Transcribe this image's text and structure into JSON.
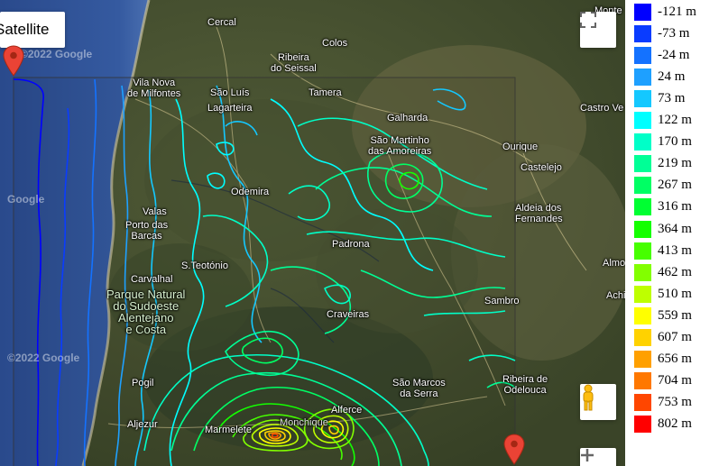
{
  "map": {
    "maptype_label": "Satellite",
    "watermark": "©2022 Google",
    "watermark2": "Google",
    "places": [
      {
        "id": "cercal",
        "text": "Cercal"
      },
      {
        "id": "ribeira-seissal",
        "text": "Ribeira\ndo Seissal"
      },
      {
        "id": "colos",
        "text": "Colos"
      },
      {
        "id": "monte",
        "text": "Monte"
      },
      {
        "id": "vila-nova",
        "text": "Vila Nova\nde Milfontes"
      },
      {
        "id": "sao-luis",
        "text": "São Luís"
      },
      {
        "id": "tamera",
        "text": "Tamera"
      },
      {
        "id": "lagarteira",
        "text": "Lagarteira"
      },
      {
        "id": "galharda",
        "text": "Galharda"
      },
      {
        "id": "castro-verde",
        "text": "Castro Ve"
      },
      {
        "id": "sao-martinho",
        "text": "São Martinho\ndas Amoreiras"
      },
      {
        "id": "ourique",
        "text": "Ourique"
      },
      {
        "id": "castelejo",
        "text": "Castelejo"
      },
      {
        "id": "odemira",
        "text": "Odemira"
      },
      {
        "id": "valas",
        "text": "Valas"
      },
      {
        "id": "aldeia",
        "text": "Aldeia dos\nFernandes"
      },
      {
        "id": "porto-barcas",
        "text": "Porto das\nBarcas"
      },
      {
        "id": "padrona",
        "text": "Padrona"
      },
      {
        "id": "s-teotonio",
        "text": "S.Teotónio"
      },
      {
        "id": "almo",
        "text": "Almo"
      },
      {
        "id": "carvalhal",
        "text": "Carvalhal"
      },
      {
        "id": "parque",
        "text": "Parque Natural\ndo Sudoeste\nAlentejano\ne Costa"
      },
      {
        "id": "achi",
        "text": "Achi"
      },
      {
        "id": "sambro",
        "text": "Sambro"
      },
      {
        "id": "craveiras",
        "text": "Craveiras"
      },
      {
        "id": "pogil",
        "text": "Pogil"
      },
      {
        "id": "sao-marcos",
        "text": "São Marcos\nda Serra"
      },
      {
        "id": "ribeira-odelouca",
        "text": "Ribeira de\nOdelouca"
      },
      {
        "id": "aljezur",
        "text": "Aljezur"
      },
      {
        "id": "marmelete",
        "text": "Marmelete"
      },
      {
        "id": "monchique",
        "text": "Monchique"
      },
      {
        "id": "alferce",
        "text": "Alferce"
      }
    ]
  },
  "legend": {
    "items": [
      {
        "label": "-121 m",
        "color": "#0000ff"
      },
      {
        "label": "-73 m",
        "color": "#0a3cff"
      },
      {
        "label": "-24 m",
        "color": "#1472ff"
      },
      {
        "label": "24 m",
        "color": "#1ea0ff"
      },
      {
        "label": "73 m",
        "color": "#14c8ff"
      },
      {
        "label": "122 m",
        "color": "#00ffff"
      },
      {
        "label": "170 m",
        "color": "#00ffc8"
      },
      {
        "label": "219 m",
        "color": "#00ff96"
      },
      {
        "label": "267 m",
        "color": "#00ff64"
      },
      {
        "label": "316 m",
        "color": "#00ff32"
      },
      {
        "label": "364 m",
        "color": "#14ff00"
      },
      {
        "label": "413 m",
        "color": "#46ff00"
      },
      {
        "label": "462 m",
        "color": "#82ff00"
      },
      {
        "label": "510 m",
        "color": "#beff00"
      },
      {
        "label": "559 m",
        "color": "#ffff00"
      },
      {
        "label": "607 m",
        "color": "#ffd200"
      },
      {
        "label": "656 m",
        "color": "#ffa000"
      },
      {
        "label": "704 m",
        "color": "#ff7800"
      },
      {
        "label": "753 m",
        "color": "#ff4600"
      },
      {
        "label": "802 m",
        "color": "#ff0000"
      }
    ]
  }
}
